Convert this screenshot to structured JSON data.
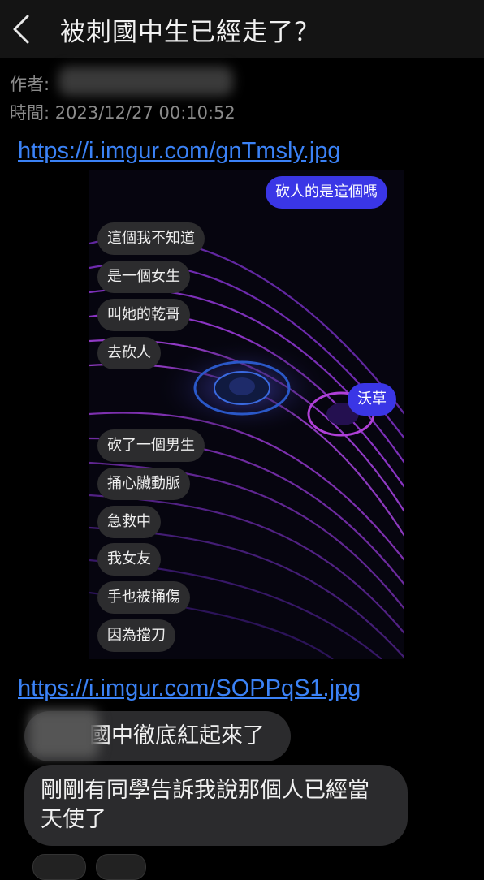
{
  "header": {
    "title": "被刺國中生已經走了？",
    "back_icon": "chevron-left-icon"
  },
  "meta": {
    "author_label": "作者:",
    "time_label": "時間:",
    "time_value": "2023/12/27 00:10:52"
  },
  "links": {
    "link1": "https://i.imgur.com/gnTmsly.jpg",
    "link2": "https://i.imgur.com/SOPPqS1.jpg"
  },
  "chat": {
    "messages": [
      {
        "dir": "out",
        "text": "砍人的是這個嗎"
      },
      {
        "dir": "in",
        "text": "這個我不知道"
      },
      {
        "dir": "in",
        "text": "是一個女生"
      },
      {
        "dir": "in",
        "text": "叫她的乾哥"
      },
      {
        "dir": "in",
        "text": "去砍人"
      },
      {
        "dir": "out",
        "text": "沃草"
      },
      {
        "dir": "in",
        "text": "砍了一個男生"
      },
      {
        "dir": "in",
        "text": "捅心臟動脈"
      },
      {
        "dir": "in",
        "text": "急救中"
      },
      {
        "dir": "in",
        "text": "我女友"
      },
      {
        "dir": "in",
        "text": "手也被捅傷"
      },
      {
        "dir": "in",
        "text": "因為擋刀"
      }
    ]
  },
  "comments": {
    "c1": "國中徹底紅起來了",
    "c2_line1": "剛剛有同學告訴我說那個人已經當",
    "c2_line2": "天使了"
  },
  "colors": {
    "link": "#3b82f6",
    "out_bubble": "#3a36e6",
    "in_bubble": "#2c2c2e"
  }
}
